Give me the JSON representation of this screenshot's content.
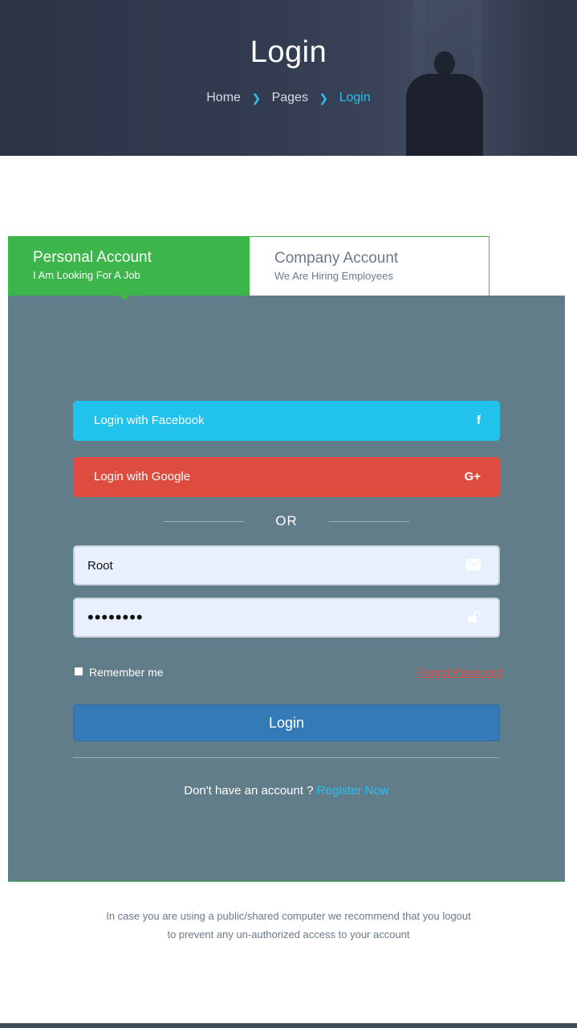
{
  "header": {
    "title": "Login",
    "breadcrumb": [
      "Home",
      "Pages",
      "Login"
    ]
  },
  "tabs": [
    {
      "title": "Personal Account",
      "subtitle": "I Am Looking For A Job",
      "active": true
    },
    {
      "title": "Company Account",
      "subtitle": "We Are Hiring Employees",
      "active": false
    }
  ],
  "social": {
    "facebook_label": "Login with Facebook",
    "google_label": "Login with Google",
    "facebook_icon": "facebook-icon",
    "google_icon": "google-plus-icon"
  },
  "or_text": "OR",
  "form": {
    "username_value": "Root",
    "password_masked": "••••••••",
    "remember_label": "Remember me",
    "remember_checked": false,
    "forgot_label": "Forgot Password",
    "submit_label": "Login"
  },
  "register": {
    "prompt": "Don't have an account ?",
    "link": "Register Now"
  },
  "notice": {
    "line1": "In case you are using a public/shared computer we recommend that you logout",
    "line2": "to prevent any un-authorized access to your account"
  },
  "colors": {
    "accent_green": "#3cb64b",
    "panel": "#627d8a",
    "facebook": "#21c2ec",
    "google": "#dd4c3f",
    "primary": "#337ab7",
    "link": "#29c0ef"
  }
}
